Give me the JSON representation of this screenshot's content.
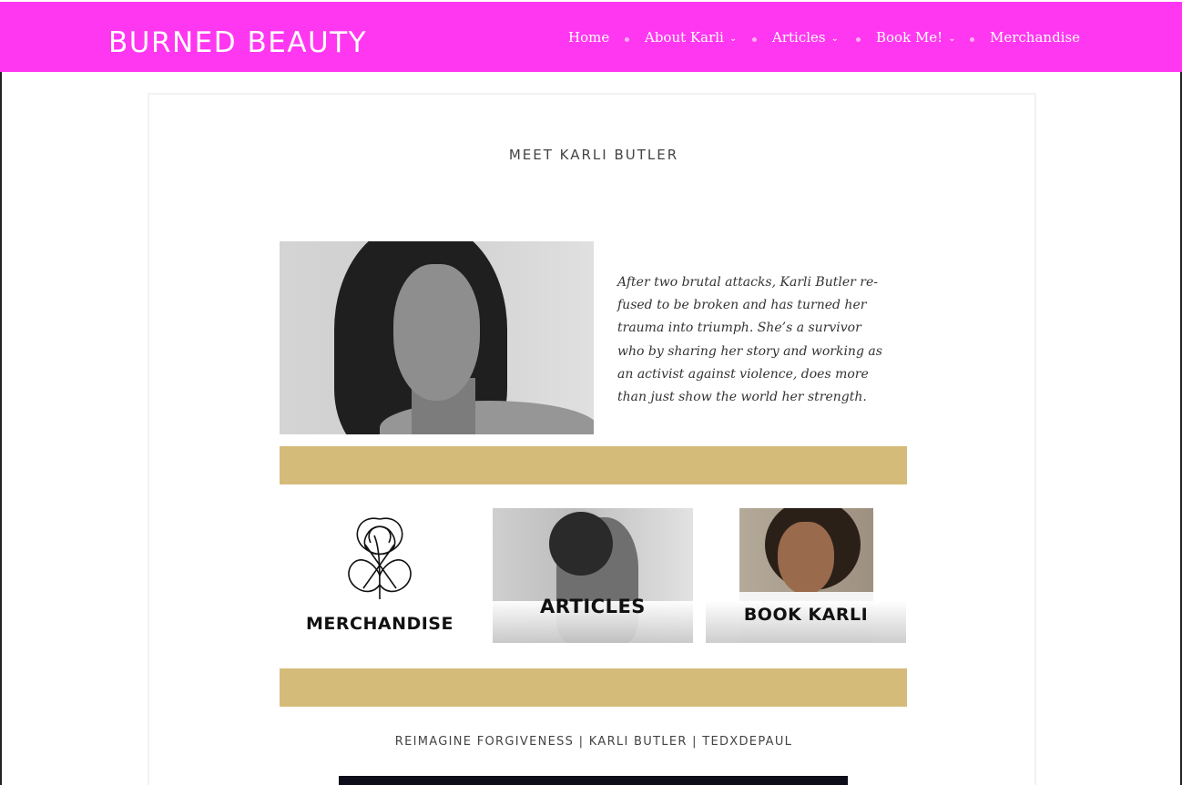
{
  "site": {
    "brand": "BURNED BEAUTY"
  },
  "nav": {
    "items": [
      {
        "label": "Home",
        "has_dropdown": false
      },
      {
        "label": "About Karli",
        "has_dropdown": true
      },
      {
        "label": "Articles",
        "has_dropdown": true
      },
      {
        "label": "Book Me!",
        "has_dropdown": true
      },
      {
        "label": "Merchandise",
        "has_dropdown": false
      }
    ]
  },
  "page": {
    "title": "MEET KARLI BUTLER",
    "intro": "After two brutal attacks, Karli Butler re­fused to be broken and has turned her trauma into triumph.  She’s a survivor who by sharing her story and working as an ac­tivist against violence, does more than just show the world her strength.",
    "tiles": [
      {
        "caption": "MERCHANDISE"
      },
      {
        "caption": "ARTICLES"
      },
      {
        "caption": "BOOK KARLI"
      }
    ],
    "video_title": "REIMAGINE FORGIVENESS | KARLI BUTLER | TEDXDEPAUL"
  },
  "colors": {
    "header_bg": "#ff37f0",
    "accent_gold": "#d5bb79",
    "text": "#333333"
  },
  "icons": {
    "dropdown": "chevron-down-icon",
    "merch_logo": "monogram-logo-icon"
  }
}
